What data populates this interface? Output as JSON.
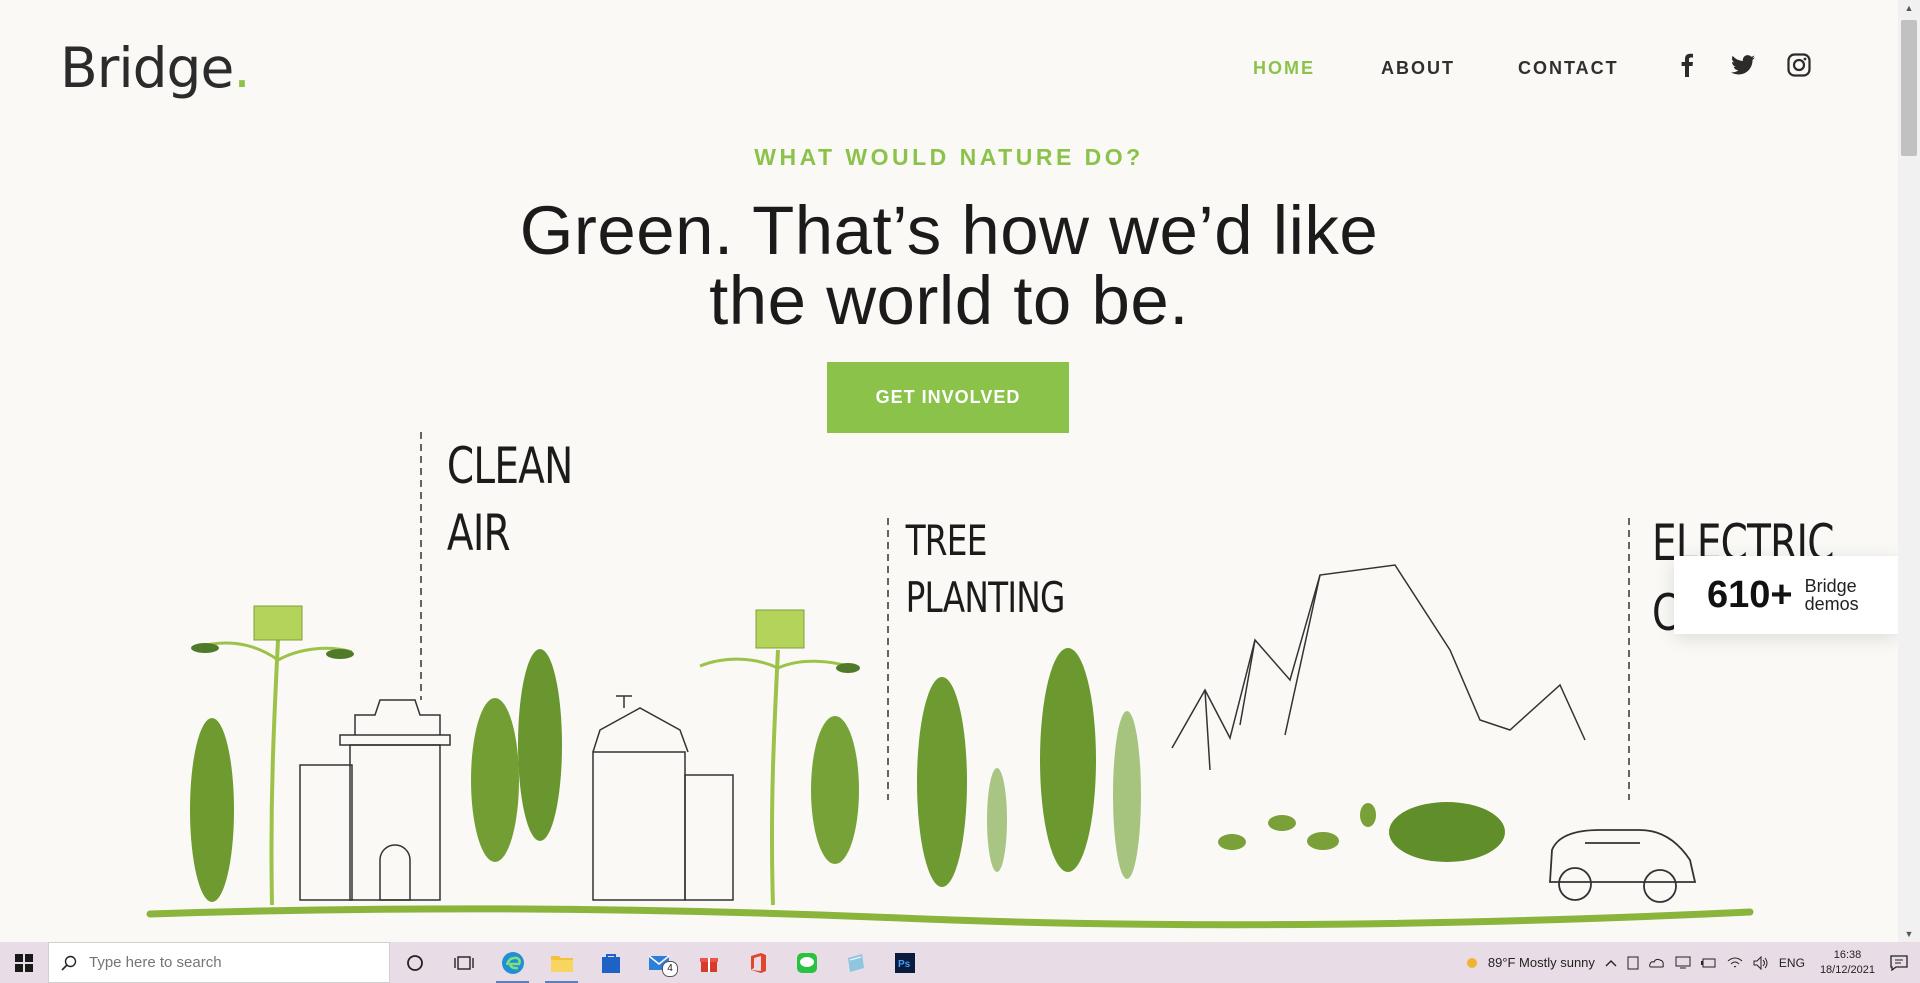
{
  "header": {
    "logo_text": "Bridge",
    "logo_dot": ".",
    "nav": [
      "HOME",
      "ABOUT",
      "CONTACT"
    ],
    "social_icons": [
      "facebook-icon",
      "twitter-icon",
      "instagram-icon"
    ]
  },
  "hero": {
    "eyebrow": "WHAT WOULD NATURE DO?",
    "headline_line1": "Green. That’s how we’d like",
    "headline_line2": "the world to be.",
    "cta_label": "GET INVOLVED"
  },
  "illustration": {
    "label1_line1": "CLEAN",
    "label1_line2": "AIR",
    "label2_line1": "TREE",
    "label2_line2": "PLANTING",
    "label3_line1": "ELECTRIC",
    "label3_line2": "CAR"
  },
  "badge": {
    "count": "610+",
    "line1": "Bridge",
    "line2": "demos"
  },
  "taskbar": {
    "search_placeholder": "Type here to search",
    "weather": "89°F  Mostly sunny",
    "language": "ENG",
    "time": "16:38",
    "date": "18/12/2021",
    "mail_badge": "4"
  },
  "colors": {
    "accent": "#8bc34a",
    "text": "#1b1b1b",
    "background": "#faf9f6",
    "taskbar": "#e8dde6"
  }
}
